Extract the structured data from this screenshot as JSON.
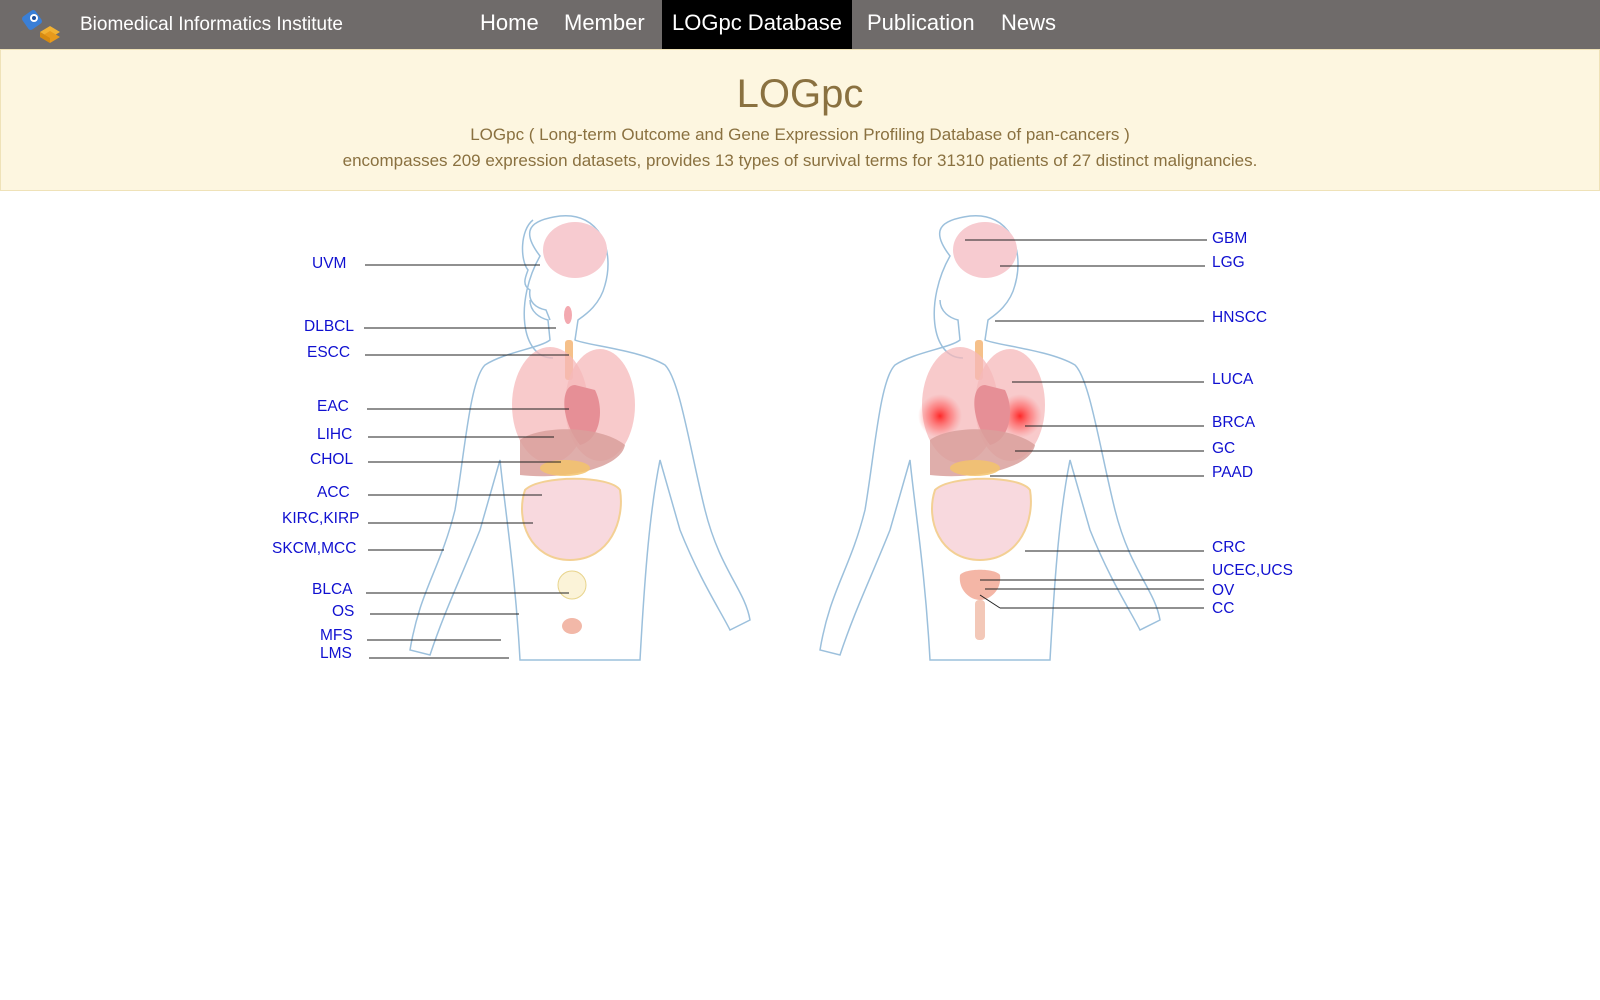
{
  "header": {
    "brand": "Biomedical Informatics Institute",
    "nav": [
      "Home",
      "Member",
      "LOGpc Database",
      "Publication",
      "News"
    ],
    "active_nav": "LOGpc Database"
  },
  "banner": {
    "title": "LOGpc",
    "line1": "LOGpc ( Long-term Outcome and Gene Expression Profiling Database of pan-cancers )",
    "line2": "encompasses 209 expression datasets, provides 13 types of survival terms for 31310 patients of 27 distinct malignancies."
  },
  "body_map": {
    "left_labels": [
      "UVM",
      "DLBCL",
      "ESCC",
      "EAC",
      "LIHC",
      "CHOL",
      "ACC",
      "KIRC,KIRP",
      "SKCM,MCC",
      "BLCA",
      "OS",
      "MFS",
      "LMS"
    ],
    "right_labels": [
      "GBM",
      "LGG",
      "HNSCC",
      "LUCA",
      "BRCA",
      "GC",
      "PAAD",
      "CRC",
      "UCEC,UCS",
      "OV",
      "CC"
    ]
  },
  "colors": {
    "navbar": "#6f6b6a",
    "banner_bg": "#fdf6e0",
    "banner_text": "#8a7140",
    "link": "#1010d0"
  }
}
